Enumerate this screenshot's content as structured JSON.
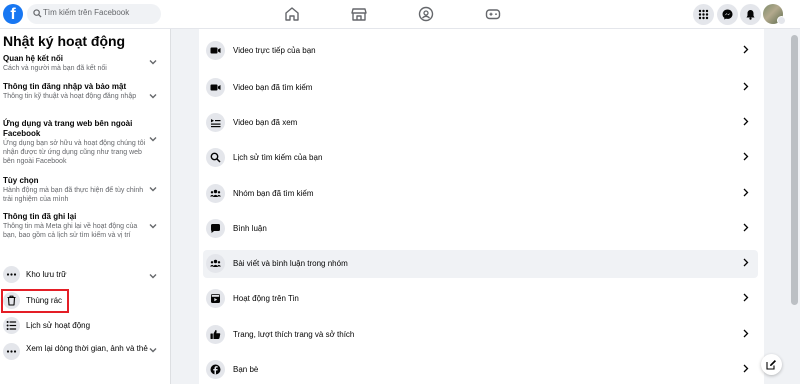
{
  "header": {
    "logo": "f",
    "search_placeholder": "Tìm kiếm trên Facebook",
    "nav_icons": [
      "home-icon",
      "marketplace-icon",
      "groups-icon",
      "gaming-icon"
    ],
    "right_icons": [
      "menu-grid-icon",
      "messenger-icon",
      "notifications-icon"
    ]
  },
  "sidebar": {
    "title": "Nhật ký hoạt động",
    "sections": [
      {
        "title": "Quan hệ kết nối",
        "desc": "Cách và người mà bạn đã kết nối"
      },
      {
        "title": "Thông tin đăng nhập và bảo mật",
        "desc": "Thông tin kỹ thuật và hoạt động đăng nhập"
      },
      {
        "title": "Ứng dụng và trang web bên ngoài Facebook",
        "desc": "Ứng dụng bạn sở hữu và hoạt động chúng tôi nhận được từ ứng dụng cũng như trang web bên ngoài Facebook"
      },
      {
        "title": "Tùy chọn",
        "desc": "Hành động mà bạn đã thực hiện để tùy chỉnh trải nghiệm của mình"
      },
      {
        "title": "Thông tin đã ghi lại",
        "desc": "Thông tin mà Meta ghi lại về hoạt động của bạn, bao gồm cả lịch sử tìm kiếm và vị trí"
      }
    ],
    "icon_items": [
      {
        "label": "Kho lưu trữ",
        "icon": "more-dots-icon"
      },
      {
        "label": "Thùng rác",
        "icon": "trash-icon"
      },
      {
        "label": "Lịch sử hoạt động",
        "icon": "list-icon"
      },
      {
        "label": "Xem lại dòng thời gian, ảnh và thẻ",
        "icon": "more-dots-icon"
      }
    ]
  },
  "main": {
    "rows": [
      {
        "label": "Video trực tiếp của bạn",
        "icon": "live-video-icon"
      },
      {
        "label": "Video bạn đã tìm kiếm",
        "icon": "video-camera-icon"
      },
      {
        "label": "Video bạn đã xem",
        "icon": "video-playlist-icon"
      },
      {
        "label": "Lịch sử tìm kiếm của bạn",
        "icon": "search-icon"
      },
      {
        "label": "Nhóm bạn đã tìm kiếm",
        "icon": "people-icon"
      },
      {
        "label": "Bình luận",
        "icon": "comment-icon"
      },
      {
        "label": "Bài viết và bình luận trong nhóm",
        "icon": "people-icon"
      },
      {
        "label": "Hoạt động trên Tin",
        "icon": "stories-icon"
      },
      {
        "label": "Trang, lượt thích trang và sở thích",
        "icon": "thumbs-up-icon"
      },
      {
        "label": "Bạn bè",
        "icon": "facebook-icon"
      }
    ]
  },
  "colors": {
    "brand": "#1877f2",
    "highlight": "#e41e26"
  }
}
